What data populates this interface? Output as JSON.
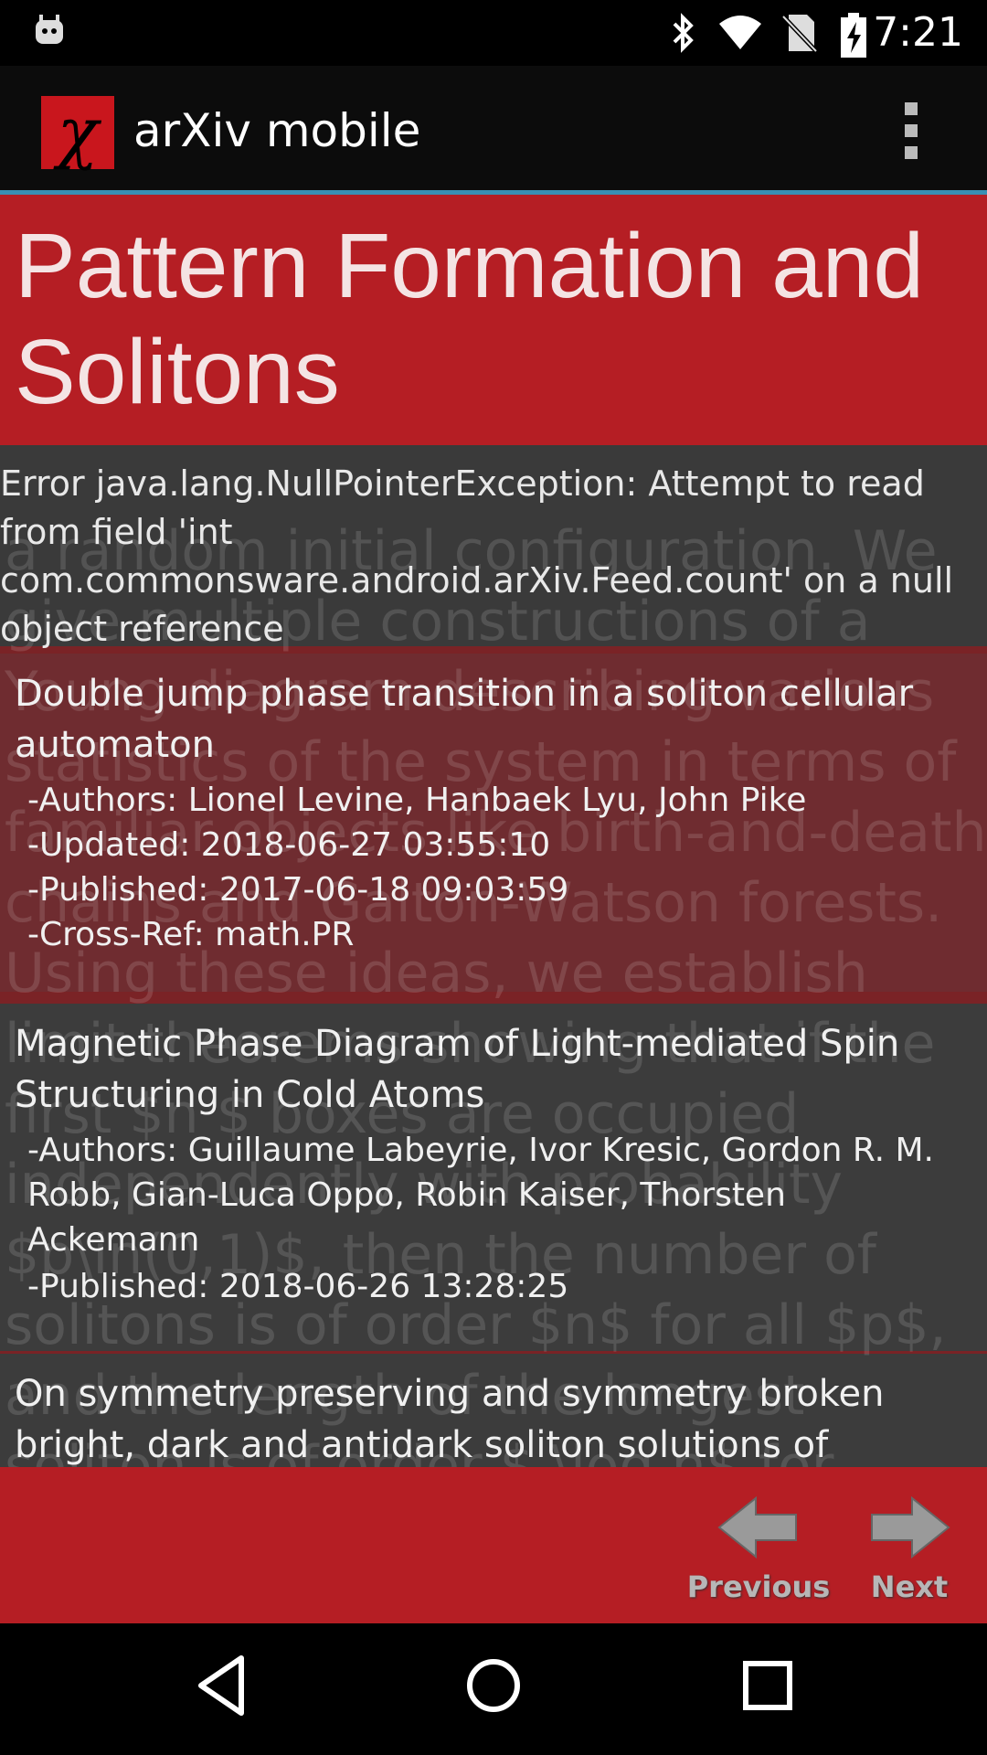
{
  "status_bar": {
    "time": "7:21",
    "icons": [
      "android-debug-icon",
      "bluetooth-icon",
      "wifi-icon",
      "no-sim-icon",
      "battery-charging-icon"
    ]
  },
  "action_bar": {
    "logo_glyph": "χ",
    "title": "arXiv mobile",
    "overflow_icon": "overflow-menu-icon"
  },
  "page_title": "Pattern Formation and Solitons",
  "error_message": "Error java.lang.NullPointerException: Attempt to read from field 'int com.commonsware.android.arXiv.Feed.count' on a null object reference",
  "background_ghost_text": "a random initial configuration. We give multiple constructions of a Young diagram describing various statistics of the system in terms of familiar objects like birth-and-death chains and Galton-Watson forests. Using these ideas, we establish limit theorems showing that if the first $n $ boxes are occupied independently with probability $p\\in(0,1)$, then the number of solitons is of order $n$ for all $p$, and the length of the longest soliton is of order $ \\log n$ for $p<1/2$, order $\\sqrt{n} $ for $p=1/2$, and order $n$ for",
  "papers": [
    {
      "title": "Double jump phase transition in a soliton cellular automaton",
      "authors": "-Authors: Lionel Levine, Hanbaek Lyu, John Pike",
      "updated": "-Updated: 2018-06-27 03:55:10",
      "published": "-Published: 2017-06-18 09:03:59",
      "cross_ref": "-Cross-Ref: math.PR"
    },
    {
      "title": "Magnetic Phase Diagram of Light-mediated Spin Structuring in Cold Atoms",
      "authors": "-Authors: Guillaume Labeyrie, Ivor Kresic, Gordon R. M. Robb, Gian-Luca Oppo, Robin Kaiser, Thorsten Ackemann",
      "published": "-Published: 2018-06-26 13:28:25"
    },
    {
      "title": "On symmetry preserving and symmetry broken bright, dark and antidark soliton solutions of"
    }
  ],
  "nav": {
    "previous_label": "Previous",
    "next_label": "Next"
  },
  "colors": {
    "accent_blue": "#3a8fb3",
    "title_red": "#b51e24",
    "error_gray": "#3a3a3a"
  }
}
